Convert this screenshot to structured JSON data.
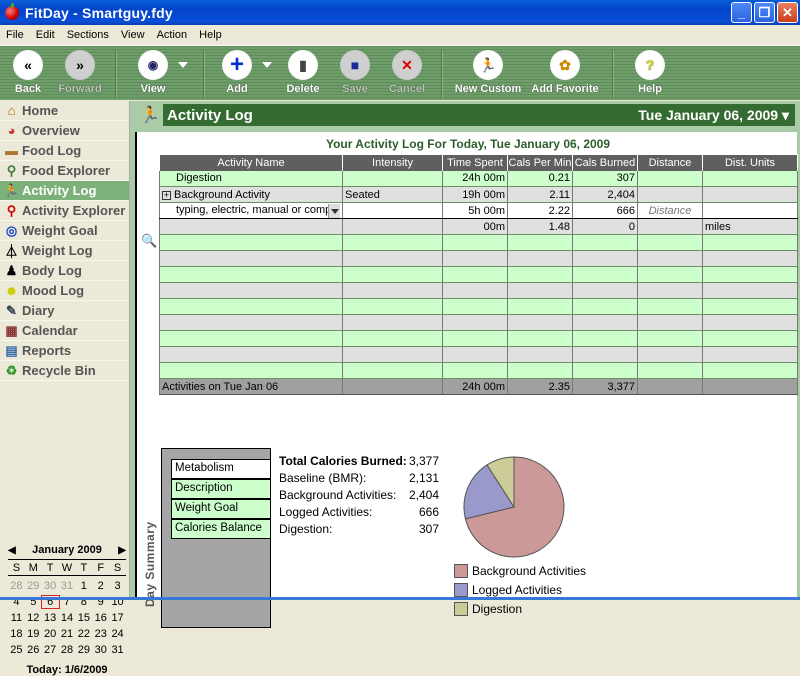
{
  "window": {
    "title": "FitDay - Smartguy.fdy"
  },
  "menu": [
    "File",
    "Edit",
    "Sections",
    "View",
    "Action",
    "Help"
  ],
  "toolbar": {
    "back": "Back",
    "forward": "Forward",
    "view": "View",
    "add": "Add",
    "delete": "Delete",
    "save": "Save",
    "cancel": "Cancel",
    "new_custom": "New Custom",
    "add_favorite": "Add Favorite",
    "help": "Help"
  },
  "sidebar": {
    "items": [
      {
        "label": "Home",
        "icon": "house-icon"
      },
      {
        "label": "Overview",
        "icon": "pie-icon"
      },
      {
        "label": "Food Log",
        "icon": "sandwich-icon"
      },
      {
        "label": "Food Explorer",
        "icon": "magnifier-food-icon"
      },
      {
        "label": "Activity Log",
        "icon": "runner-icon",
        "active": true
      },
      {
        "label": "Activity Explorer",
        "icon": "magnifier-runner-icon"
      },
      {
        "label": "Weight Goal",
        "icon": "target-icon"
      },
      {
        "label": "Weight Log",
        "icon": "scale-icon"
      },
      {
        "label": "Body Log",
        "icon": "body-icon"
      },
      {
        "label": "Mood Log",
        "icon": "smiley-icon"
      },
      {
        "label": "Diary",
        "icon": "diary-icon"
      },
      {
        "label": "Calendar",
        "icon": "calendar-icon"
      },
      {
        "label": "Reports",
        "icon": "reports-icon"
      },
      {
        "label": "Recycle Bin",
        "icon": "recycle-icon"
      }
    ]
  },
  "calendar": {
    "month": "January 2009",
    "dow": [
      "S",
      "M",
      "T",
      "W",
      "T",
      "F",
      "S"
    ],
    "prev_month_days": [
      "28",
      "29",
      "30",
      "31"
    ],
    "days": [
      "1",
      "2",
      "3",
      "4",
      "5",
      "6",
      "7",
      "8",
      "9",
      "10",
      "11",
      "12",
      "13",
      "14",
      "15",
      "16",
      "17",
      "18",
      "19",
      "20",
      "21",
      "22",
      "23",
      "24",
      "25",
      "26",
      "27",
      "28",
      "29",
      "30",
      "31"
    ],
    "selected": "6",
    "today": "Today: 1/6/2009"
  },
  "header": {
    "title": "Activity Log",
    "date": "Tue January 06, 2009"
  },
  "log": {
    "title": "Your Activity Log For Today, Tue January 06, 2009",
    "columns": [
      "Activity Name",
      "Intensity",
      "Time Spent",
      "Cals Per Min",
      "Cals Burned",
      "Distance",
      "Dist. Units"
    ],
    "rows": [
      {
        "name": "Digestion",
        "intensity": "",
        "time": "24h 00m",
        "cpm": "0.21",
        "burned": "307",
        "distance": "",
        "units": ""
      },
      {
        "name": "Background Activity",
        "intensity": "Seated",
        "time": "19h 00m",
        "cpm": "2.11",
        "burned": "2,404",
        "distance": "",
        "units": ""
      },
      {
        "name": "typing, electric, manual or comp",
        "intensity": "",
        "time": "5h 00m",
        "cpm": "2.22",
        "burned": "666",
        "distance": "Distance",
        "units": ""
      },
      {
        "name": "",
        "intensity": "",
        "time": "00m",
        "cpm": "1.48",
        "burned": "0",
        "distance": "",
        "units": "miles"
      }
    ],
    "totals": {
      "name": "Activities on Tue Jan 06",
      "time": "24h 00m",
      "cpm": "2.35",
      "burned": "3,377"
    }
  },
  "day_summary": {
    "label": "Day Summary",
    "tabs": [
      "Metabolism",
      "Description",
      "Weight Goal",
      "Calories Balance"
    ],
    "stats": [
      {
        "k": "Total Calories Burned:",
        "v": "3,377"
      },
      {
        "k": "Baseline (BMR):",
        "v": "2,131"
      },
      {
        "k": "Background Activities:",
        "v": "2,404"
      },
      {
        "k": "Logged Activities:",
        "v": "666"
      },
      {
        "k": "Digestion:",
        "v": "307"
      }
    ]
  },
  "chart_data": {
    "type": "pie",
    "title": "",
    "labels": [
      "Background Activities",
      "Logged Activities",
      "Digestion"
    ],
    "values": [
      2404,
      666,
      307
    ],
    "colors": [
      "#cc9999",
      "#9999cc",
      "#cccc99"
    ],
    "legend": "bottom"
  }
}
